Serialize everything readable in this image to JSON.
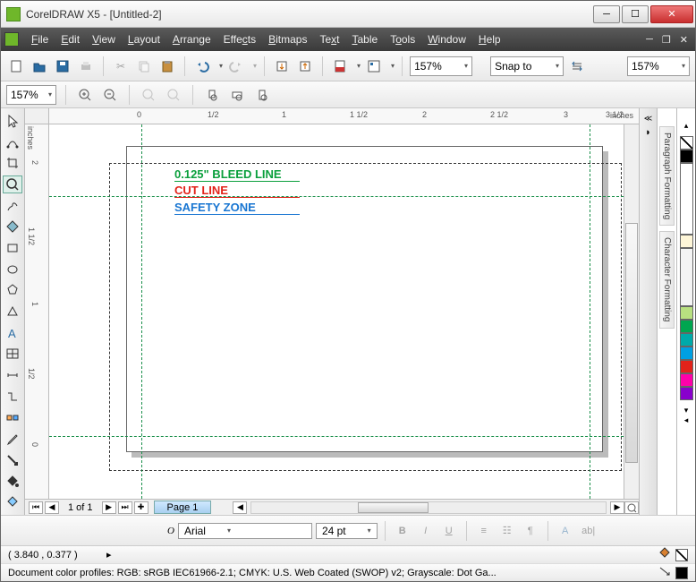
{
  "titlebar": {
    "title": "CorelDRAW X5 - [Untitled-2]"
  },
  "menus": {
    "file": "File",
    "edit": "Edit",
    "view": "View",
    "layout": "Layout",
    "arrange": "Arrange",
    "effects": "Effects",
    "bitmaps": "Bitmaps",
    "text": "Text",
    "table": "Table",
    "tools": "Tools",
    "window": "Window",
    "help": "Help"
  },
  "toolbar": {
    "zoom_combo": "157%",
    "snap_combo": "Snap to",
    "zoom_right": "157%"
  },
  "propertybar": {
    "zoom": "157%"
  },
  "ruler": {
    "unit": "inches",
    "ticks": [
      "0",
      "1/2",
      "1",
      "1 1/2",
      "2",
      "2 1/2",
      "3",
      "3 1/2"
    ]
  },
  "ruler_v": {
    "unit": "inches",
    "ticks": [
      "2",
      "1 1/2",
      "1",
      "1/2",
      "0"
    ]
  },
  "canvas": {
    "bleed_label": "0.125\" BLEED LINE",
    "cut_label": "CUT LINE",
    "safety_label": "SAFETY ZONE"
  },
  "pagebar": {
    "counter": "1 of 1",
    "tab": "Page 1"
  },
  "right_tabs": {
    "para": "Paragraph Formatting",
    "char": "Character Formatting"
  },
  "palette": [
    "none",
    "#000000",
    "#ffffff",
    "#fef6d8",
    "#e8e8e8",
    "#9e9e9e",
    "#b8e080",
    "#6dc24a",
    "#00a0e3",
    "#f26d9a",
    "#e2231a",
    "#ffe600",
    "#ff6600",
    "#ff00aa",
    "#00a650"
  ],
  "fontbar": {
    "font": "Arial",
    "size": "24 pt"
  },
  "status": {
    "coords": "( 3.840 , 0.377 )",
    "profiles": "Document color profiles: RGB: sRGB IEC61966-2.1; CMYK: U.S. Web Coated (SWOP) v2; Grayscale: Dot Ga..."
  }
}
